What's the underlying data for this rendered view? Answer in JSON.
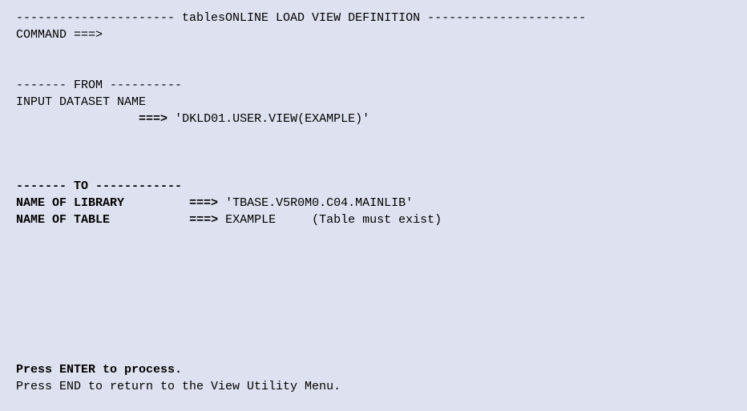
{
  "header": {
    "title_line": "---------------------- tablesONLINE LOAD VIEW DEFINITION ----------------------",
    "command_label": "COMMAND ===>",
    "command_value": ""
  },
  "from_section": {
    "header_line": "------- FROM ----------",
    "dataset_label": "INPUT DATASET NAME",
    "dataset_prompt": "===>",
    "dataset_value": "'DKLD01.USER.VIEW(EXAMPLE)'"
  },
  "to_section": {
    "header_line": "------- TO ------------",
    "library_label": "NAME OF LIBRARY",
    "library_prompt": "===>",
    "library_value": "'TBASE.V5R0M0.C04.MAINLIB'",
    "table_label": "NAME OF TABLE",
    "table_prompt": "===>",
    "table_value": "EXAMPLE",
    "table_hint": "(Table must exist)"
  },
  "footer": {
    "enter_line": "Press ENTER to process.",
    "end_line": "Press END to return to the View Utility Menu."
  }
}
